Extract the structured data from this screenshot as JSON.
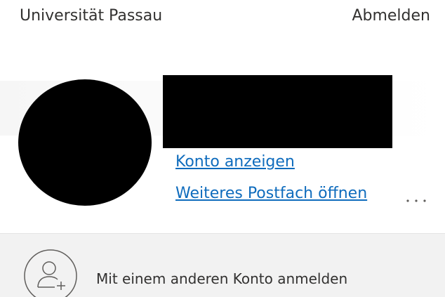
{
  "header": {
    "org_name": "Universität Passau",
    "sign_out_label": "Abmelden"
  },
  "account": {
    "view_account_label": "Konto anzeigen",
    "open_other_mailbox_label": "Weiteres Postfach öffnen",
    "more_options_icon": "ellipsis-icon"
  },
  "other_account": {
    "label": "Mit einem anderen Konto anmelden",
    "icon": "add-person-icon"
  },
  "colors": {
    "link": "#0f6cbd",
    "text": "#323130",
    "footer_background": "#f2f2f2"
  }
}
